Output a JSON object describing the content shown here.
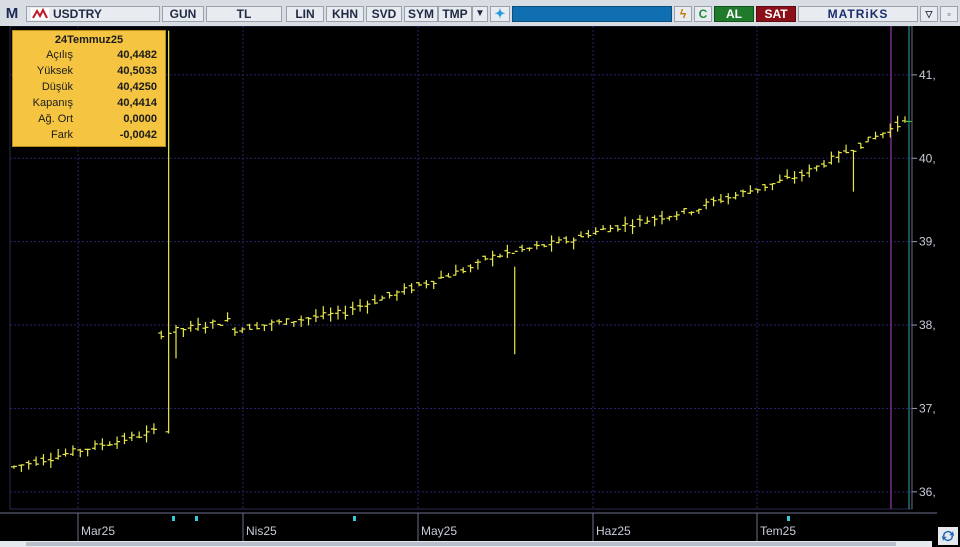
{
  "toolbar": {
    "menu": "M",
    "symbol": "USDTRY",
    "period": "GUN",
    "currency": "TL",
    "buttons": [
      "LIN",
      "KHN",
      "SVD",
      "SYM",
      "TMP"
    ],
    "buy": "AL",
    "sell": "SAT",
    "brand": "MATRiKS"
  },
  "legend": {
    "date": "24Temmuz25",
    "rows": [
      {
        "label": "Açılış",
        "value": "40,4482"
      },
      {
        "label": "Yüksek",
        "value": "40,5033"
      },
      {
        "label": "Düşük",
        "value": "40,4250"
      },
      {
        "label": "Kapanış",
        "value": "40,4414"
      },
      {
        "label": "Ağ. Ort",
        "value": "0,0000"
      },
      {
        "label": "Fark",
        "value": "-0,0042"
      }
    ]
  },
  "chart_data": {
    "type": "ohlc",
    "series_color": "#e9e94a",
    "y_ticks": [
      "36,",
      "37,",
      "38,",
      "39,",
      "40,",
      "41,"
    ],
    "ylim": [
      35.95,
      41.55
    ],
    "x_months": [
      "Mar25",
      "Nis25",
      "May25",
      "Haz25",
      "Tem25"
    ],
    "segments": [
      {
        "n": 20,
        "from": 36.3,
        "to": 36.72
      },
      {
        "n": 10,
        "from": 37.9,
        "to": 38.05
      },
      {
        "n": 16,
        "from": 37.95,
        "to": 38.15
      },
      {
        "n": 18,
        "from": 38.2,
        "to": 38.72
      },
      {
        "n": 14,
        "from": 38.8,
        "to": 39.05
      },
      {
        "n": 16,
        "from": 39.1,
        "to": 39.4
      },
      {
        "n": 14,
        "from": 39.45,
        "to": 39.8
      },
      {
        "n": 14,
        "from": 39.85,
        "to": 40.44
      }
    ],
    "notable_bars": [
      {
        "index": 21,
        "high": 41.53,
        "low": 36.7,
        "open": 36.72,
        "close": 37.9
      },
      {
        "index": 22,
        "high": 38.0,
        "low": 37.6
      },
      {
        "index": 68,
        "high": 38.7,
        "low": 37.65
      },
      {
        "index": 114,
        "high": 40.1,
        "low": 39.6
      }
    ],
    "last": {
      "open": 40.4482,
      "high": 40.5033,
      "low": 40.425,
      "close": 40.4414
    }
  }
}
